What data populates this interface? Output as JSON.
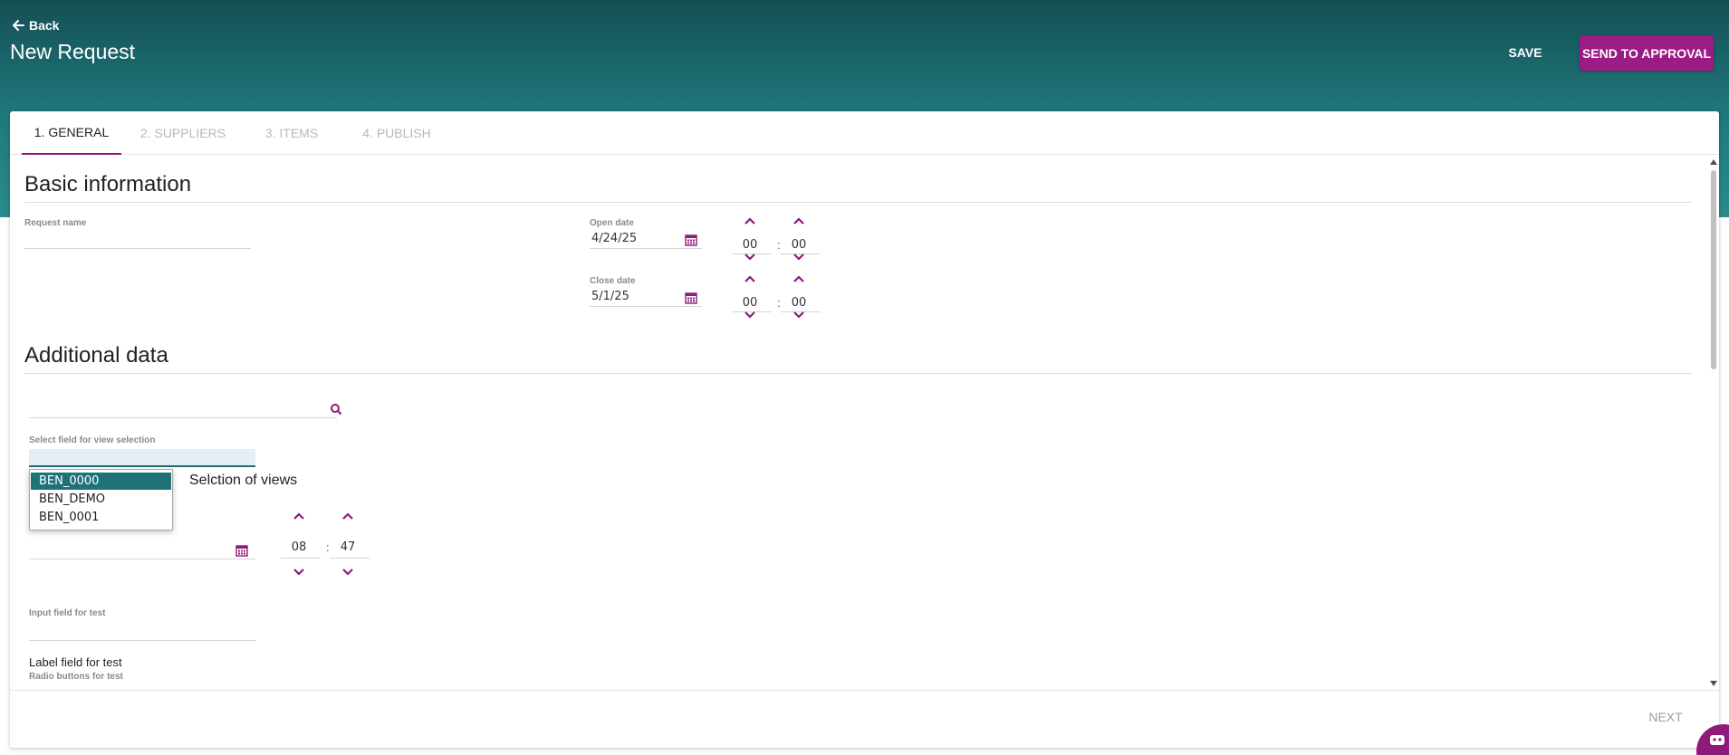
{
  "header": {
    "back_label": "Back",
    "title": "New Request",
    "save_label": "SAVE",
    "send_label": "SEND TO APPROVAL"
  },
  "tabs": [
    {
      "label": "1. GENERAL",
      "active": true
    },
    {
      "label": "2. SUPPLIERS",
      "active": false
    },
    {
      "label": "3. ITEMS",
      "active": false
    },
    {
      "label": "4. PUBLISH",
      "active": false
    }
  ],
  "basic": {
    "title": "Basic information",
    "request_name_label": "Request name",
    "request_name_value": "",
    "open_date_label": "Open date",
    "open_date_value": "4/24/25",
    "open_hour": "00",
    "open_minute": "00",
    "close_date_label": "Close date",
    "close_date_value": "5/1/25",
    "close_hour": "00",
    "close_minute": "00"
  },
  "additional": {
    "title": "Additional data",
    "search_value": "",
    "select_label": "Select field for view selection",
    "dropdown_options": [
      "BEN_0000",
      "BEN_DEMO",
      "BEN_0001"
    ],
    "selected_option": "BEN_0000",
    "views_title": "Selction of views",
    "date_value": "",
    "hour": "08",
    "minute": "47",
    "input_label": "Input field for test",
    "input_value": "",
    "label_field": "Label field for test",
    "radio_label": "Radio buttons for test"
  },
  "footer": {
    "next_label": "NEXT"
  },
  "colors": {
    "accent": "#9c1b84",
    "header_dark": "#154f55",
    "header_light": "#2a8b8c",
    "selected_option": "#1f7378"
  }
}
